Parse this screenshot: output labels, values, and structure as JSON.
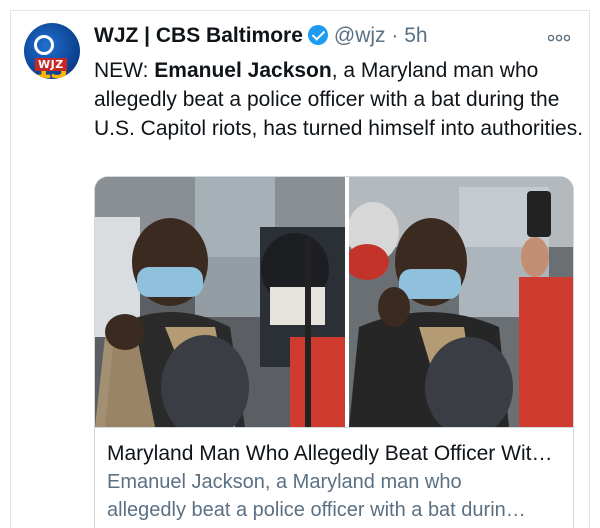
{
  "account": {
    "name": "WJZ | CBS Baltimore",
    "handle": "@wjz",
    "separator": "·",
    "time": "5h",
    "avatar": {
      "logo_number": "13",
      "logo_text": "WJZ"
    },
    "verified": true,
    "more_icon": "more-icon"
  },
  "tweet": {
    "prefix": "NEW: ",
    "bold": "Emanuel Jackson",
    "body": ", a Maryland man who allegedly beat a police officer with a bat during the U.S. Capitol riots, has turned himself into authorities."
  },
  "card": {
    "title": "Maryland Man Who Allegedly Beat Officer Wit…",
    "description_line1": "Emanuel Jackson, a Maryland man who",
    "description_line2": "allegedly beat a police officer with a bat durin…"
  },
  "colors": {
    "text": "#0f1419",
    "secondary": "#5b7083",
    "verified": "#1d9bf0",
    "border": "#cfd9de"
  }
}
